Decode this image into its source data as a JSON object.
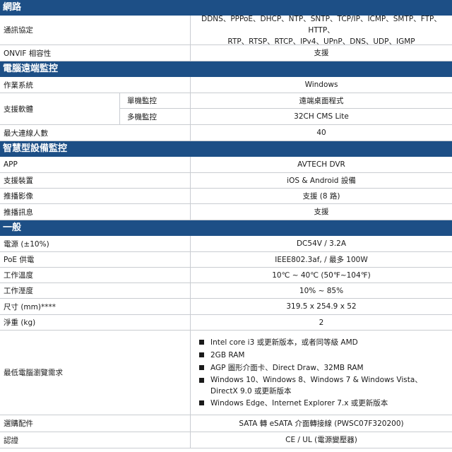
{
  "network": {
    "header": "網路",
    "protocol_label": "通訊協定",
    "protocol_line1": "DDNS、PPPoE、DHCP、NTP、SNTP、TCP/IP、ICMP、SMTP、FTP、HTTP、",
    "protocol_line2": "RTP、RTSP、RTCP、IPv4、UPnP、DNS、UDP、IGMP",
    "onvif_label": "ONVIF 相容性",
    "onvif_value": "支援"
  },
  "pc_remote": {
    "header": "電腦遠端監控",
    "os_label": "作業系統",
    "os_value": "Windows",
    "software_label": "支援軟體",
    "single_label": "單機監控",
    "single_value": "遠端桌面程式",
    "multi_label": "多機監控",
    "multi_value": "32CH CMS Lite",
    "max_users_label": "最大連線人數",
    "max_users_value": "40"
  },
  "smart": {
    "header": "智慧型設備監控",
    "app_label": "APP",
    "app_value": "AVTECH DVR",
    "devices_label": "支援裝置",
    "devices_value": "iOS & Android 設備",
    "push_video_label": "推播影像",
    "push_video_value": "支援 (8 路)",
    "push_msg_label": "推播訊息",
    "push_msg_value": "支援"
  },
  "general": {
    "header": "一般",
    "power_label": "電源 (±10%)",
    "power_value": "DC54V / 3.2A",
    "poe_label": "PoE 供電",
    "poe_value": "IEEE802.3af, / 最多 100W",
    "temp_label": "工作溫度",
    "temp_value": "10℃ ~ 40℃ (50℉~104℉)",
    "humidity_label": "工作溼度",
    "humidity_value": "10% ~ 85%",
    "size_label": "尺寸 (mm)****",
    "size_value": "319.5 x 254.9 x 52",
    "weight_label": "淨重 (kg)",
    "weight_value": "2",
    "min_pc_label": "最低電腦瀏覽需求",
    "min_pc_items": [
      "Intel core i3 或更新版本，或者同等級 AMD",
      "2GB RAM",
      "AGP 圖形介面卡、Direct Draw、32MB RAM",
      "Windows 10、Windows 8、Windows 7 & Windows Vista、",
      "DirectX 9.0 或更新版本",
      "Windows Edge、Internet Explorer 7.x 或更新版本"
    ],
    "accessory_label": "選購配件",
    "accessory_value": "SATA 轉 eSATA 介面轉接線 (PWSC07F320200)",
    "cert_label": "認證",
    "cert_value": "CE / UL (電源變壓器)"
  }
}
